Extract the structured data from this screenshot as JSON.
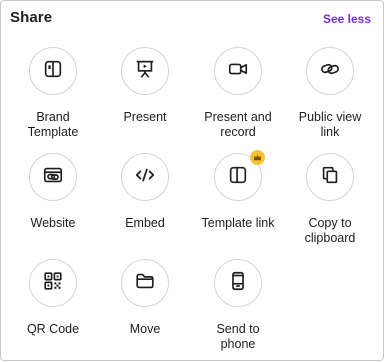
{
  "header": {
    "title": "Share",
    "see_less": "See less"
  },
  "items": [
    {
      "label": "Brand\nTemplate",
      "icon": "brand-template-icon"
    },
    {
      "label": "Present",
      "icon": "present-icon"
    },
    {
      "label": "Present and\nrecord",
      "icon": "video-camera-icon"
    },
    {
      "label": "Public view\nlink",
      "icon": "link-icon"
    },
    {
      "label": "Website",
      "icon": "website-icon"
    },
    {
      "label": "Embed",
      "icon": "code-icon"
    },
    {
      "label": "Template link",
      "icon": "template-link-icon",
      "badge": "crown-icon"
    },
    {
      "label": "Copy to\nclipboard",
      "icon": "copy-icon"
    },
    {
      "label": "QR Code",
      "icon": "qr-code-icon"
    },
    {
      "label": "Move",
      "icon": "folder-icon"
    },
    {
      "label": "Send to\nphone",
      "icon": "phone-icon"
    }
  ],
  "colors": {
    "accent": "#7d2ae8",
    "crown": "#f6c330",
    "border": "#d4d4d4"
  }
}
